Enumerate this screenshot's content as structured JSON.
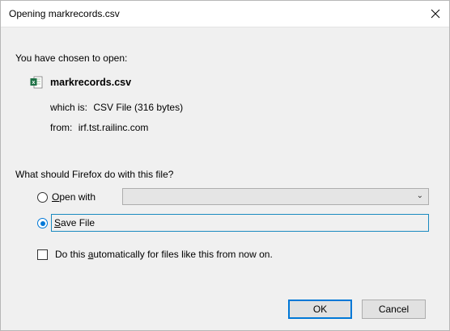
{
  "window": {
    "title": "Opening markrecords.csv"
  },
  "dialog": {
    "chosen_label": "You have chosen to open:",
    "file_name": "markrecords.csv",
    "file_icon": "csv-spreadsheet-icon",
    "which_label": "which is:",
    "which_value": "CSV File (316 bytes)",
    "from_label": "from:",
    "from_value": "irf.tst.railinc.com",
    "question": "What should Firefox do with this file?",
    "options": {
      "open_with": {
        "prefix": "O",
        "rest": "pen with",
        "selected": false
      },
      "save_file": {
        "prefix": "S",
        "rest": "ave File",
        "selected": true
      }
    },
    "open_with_select_value": "",
    "auto_checkbox": {
      "before": "Do this ",
      "underline": "a",
      "after": "utomatically for files like this from now on.",
      "checked": false
    },
    "buttons": {
      "ok": "OK",
      "cancel": "Cancel"
    }
  },
  "colors": {
    "accent": "#0078d7",
    "focus_border": "#1a8ac0",
    "panel_bg": "#f0f0f0"
  }
}
